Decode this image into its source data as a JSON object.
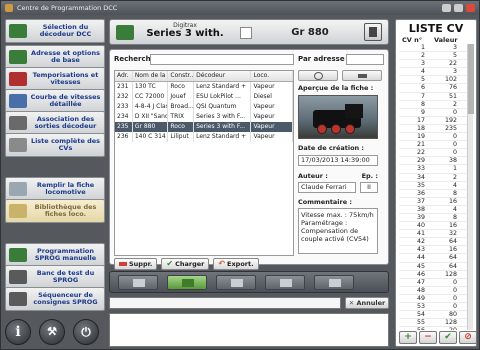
{
  "window": {
    "title": "Centre de Programmation DCC"
  },
  "sidebar": {
    "items": [
      {
        "label": "Sélection du décodeur DCC",
        "icon": "decoder-icon"
      },
      {
        "label": "Adresse et options de base",
        "icon": "address-icon"
      },
      {
        "label": "Temporisations et vitesses",
        "icon": "timer-icon"
      },
      {
        "label": "Courbe de vitesses détaillée",
        "icon": "curve-icon"
      },
      {
        "label": "Association des sorties décodeur",
        "icon": "outputs-icon"
      },
      {
        "label": "Liste complète des CVs",
        "icon": "list-icon"
      },
      {
        "label": "Remplir la fiche locomotive",
        "icon": "fill-icon"
      },
      {
        "label": "Bibliothèque des fiches loco.",
        "icon": "library-icon"
      },
      {
        "label": "Programmation SPROG manuelle",
        "icon": "sprog-icon"
      },
      {
        "label": "Banc de test du SPROG",
        "icon": "test-icon"
      },
      {
        "label": "Séquenceur de consignes SPROG",
        "icon": "sequencer-icon"
      }
    ]
  },
  "bottom_icons": {
    "info": "i",
    "tools": "tools-icon",
    "power": "power-icon"
  },
  "header": {
    "brand": "Digitrax",
    "decoder": "Series 3 with.",
    "address": "Gr 880"
  },
  "search": {
    "label": "Recherche :",
    "by_address_label": "Par adresse :"
  },
  "table": {
    "columns": [
      "Adr.",
      "Nom de la ...",
      "Constr...",
      "Décodeur",
      "Loco."
    ],
    "rows": [
      [
        "231",
        "130 TC",
        "Roco",
        "Lenz Standard +",
        "Vapeur"
      ],
      [
        "232",
        "CC 72000",
        "Jouef",
        "ESU LokPilot ...",
        "Diesel"
      ],
      [
        "233",
        "4-8-4 J Class",
        "Broad...",
        "QSI Quantum",
        "Vapeur"
      ],
      [
        "234",
        "D XII \"Sand\"",
        "TRIX",
        "Series 3 with F...",
        "Vapeur"
      ],
      [
        "235",
        "Gr 880",
        "Roco",
        "Series 3 with F...",
        "Vapeur"
      ],
      [
        "236",
        "140 C 314",
        "Liliput",
        "Lenz Standard +",
        "Vapeur"
      ]
    ],
    "selected_index": 4
  },
  "actions": {
    "delete": "Suppr.",
    "load": "Charger",
    "export": "Export."
  },
  "preview": {
    "title": "Aperçue de la fiche :",
    "created_label": "Date de création :",
    "created_value": "17/03/2013 14:39:00",
    "author_label": "Auteur :",
    "edition_label": "Ep. :",
    "author_value": "Claude Ferrari",
    "edition_value": "II",
    "comment_label": "Commentaire :",
    "comment_lines": [
      "Vitesse max. : 75km/h",
      "Paramétrage :",
      "Compensation de couple activé (CV54)"
    ]
  },
  "command": {
    "cancel_label": "Annuler"
  },
  "cv": {
    "title": "LISTE CV",
    "col_num": "CV n°",
    "col_val": "Valeur",
    "rows": [
      [
        1,
        3
      ],
      [
        2,
        5
      ],
      [
        3,
        22
      ],
      [
        4,
        3
      ],
      [
        5,
        102
      ],
      [
        6,
        76
      ],
      [
        7,
        51
      ],
      [
        8,
        2
      ],
      [
        9,
        0
      ],
      [
        17,
        192
      ],
      [
        18,
        235
      ],
      [
        19,
        0
      ],
      [
        21,
        0
      ],
      [
        22,
        0
      ],
      [
        29,
        38
      ],
      [
        33,
        1
      ],
      [
        34,
        2
      ],
      [
        35,
        4
      ],
      [
        36,
        8
      ],
      [
        37,
        16
      ],
      [
        38,
        4
      ],
      [
        39,
        8
      ],
      [
        40,
        16
      ],
      [
        41,
        32
      ],
      [
        42,
        64
      ],
      [
        43,
        16
      ],
      [
        44,
        64
      ],
      [
        45,
        64
      ],
      [
        46,
        128
      ],
      [
        47,
        0
      ],
      [
        48,
        0
      ],
      [
        49,
        0
      ],
      [
        53,
        0
      ],
      [
        54,
        80
      ],
      [
        55,
        128
      ],
      [
        56,
        20
      ]
    ]
  },
  "colors": {
    "accent_blue": "#1a3a8a",
    "selection": "#4b5968",
    "frame": "#55595e"
  }
}
